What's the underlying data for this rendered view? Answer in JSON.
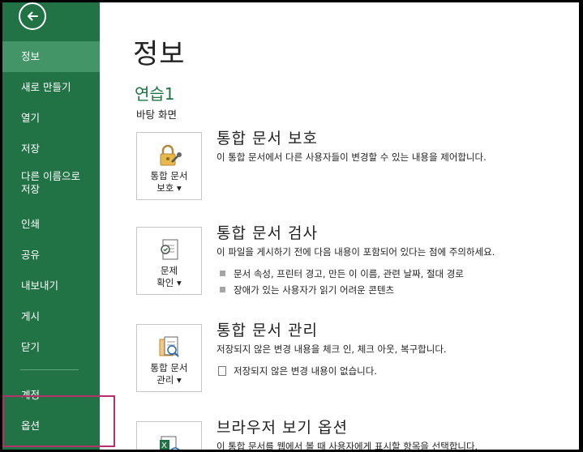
{
  "sidebar": {
    "items": [
      {
        "label": "정보"
      },
      {
        "label": "새로 만들기"
      },
      {
        "label": "열기"
      },
      {
        "label": "저장"
      },
      {
        "label": "다른 이름으로\n저장"
      },
      {
        "label": "인쇄"
      },
      {
        "label": "공유"
      },
      {
        "label": "내보내기"
      },
      {
        "label": "게시"
      },
      {
        "label": "닫기"
      },
      {
        "label": "계정"
      },
      {
        "label": "옵션"
      }
    ],
    "active_index": 0
  },
  "main": {
    "title": "정보",
    "file_name": "연습1",
    "file_location": "바탕 화면",
    "sections": [
      {
        "button_line1": "통합 문서",
        "button_line2": "보호 ▾",
        "title": "통합 문서 보호",
        "description": "이 통합 문서에서 다른 사용자들이 변경할 수 있는 내용을 제어합니다.",
        "icon": "lock-key-icon"
      },
      {
        "button_line1": "문제",
        "button_line2": "확인 ▾",
        "title": "통합 문서 검사",
        "description": "이 파일을 게시하기 전에 다음 내용이 포함되어 있다는 점에 주의하세요.",
        "bullets": [
          "문서 속성, 프린터 경고, 만든 이 이름, 관련 날짜, 절대 경로",
          "장애가 있는 사용자가 읽기 어려운 콘텐츠"
        ],
        "icon": "inspect-document-icon"
      },
      {
        "button_line1": "통합 문서",
        "button_line2": "관리 ▾",
        "title": "통합 문서 관리",
        "description": "저장되지 않은 변경 내용을 체크 인, 체크 아웃, 복구합니다.",
        "bullets": [
          "저장되지 않은 변경 내용이 없습니다."
        ],
        "icon": "manage-workbook-icon"
      },
      {
        "title": "브라우저 보기 옵션",
        "description": "이 통합 문서를 웹에서 볼 때 사용자에게 표시할 항목을 선택합니다.",
        "icon": "browser-view-icon"
      }
    ]
  },
  "colors": {
    "sidebar_bg": "#217346",
    "sidebar_active": "#439467",
    "accent_green": "#217346",
    "highlight_border": "#b5306b"
  }
}
